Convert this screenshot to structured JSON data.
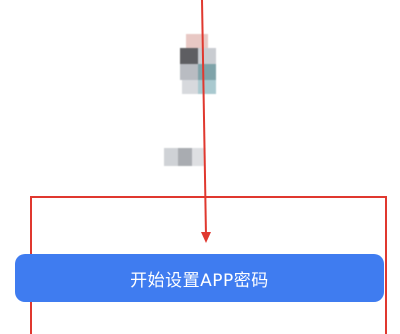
{
  "main": {
    "start_button_label": "开始设置APP密码"
  },
  "colors": {
    "primary_button": "#3f7cf0",
    "annotation": "#e0382f"
  },
  "icons": {
    "avatar": "blurred-avatar",
    "annotation_arrow": "arrow-down-icon"
  }
}
